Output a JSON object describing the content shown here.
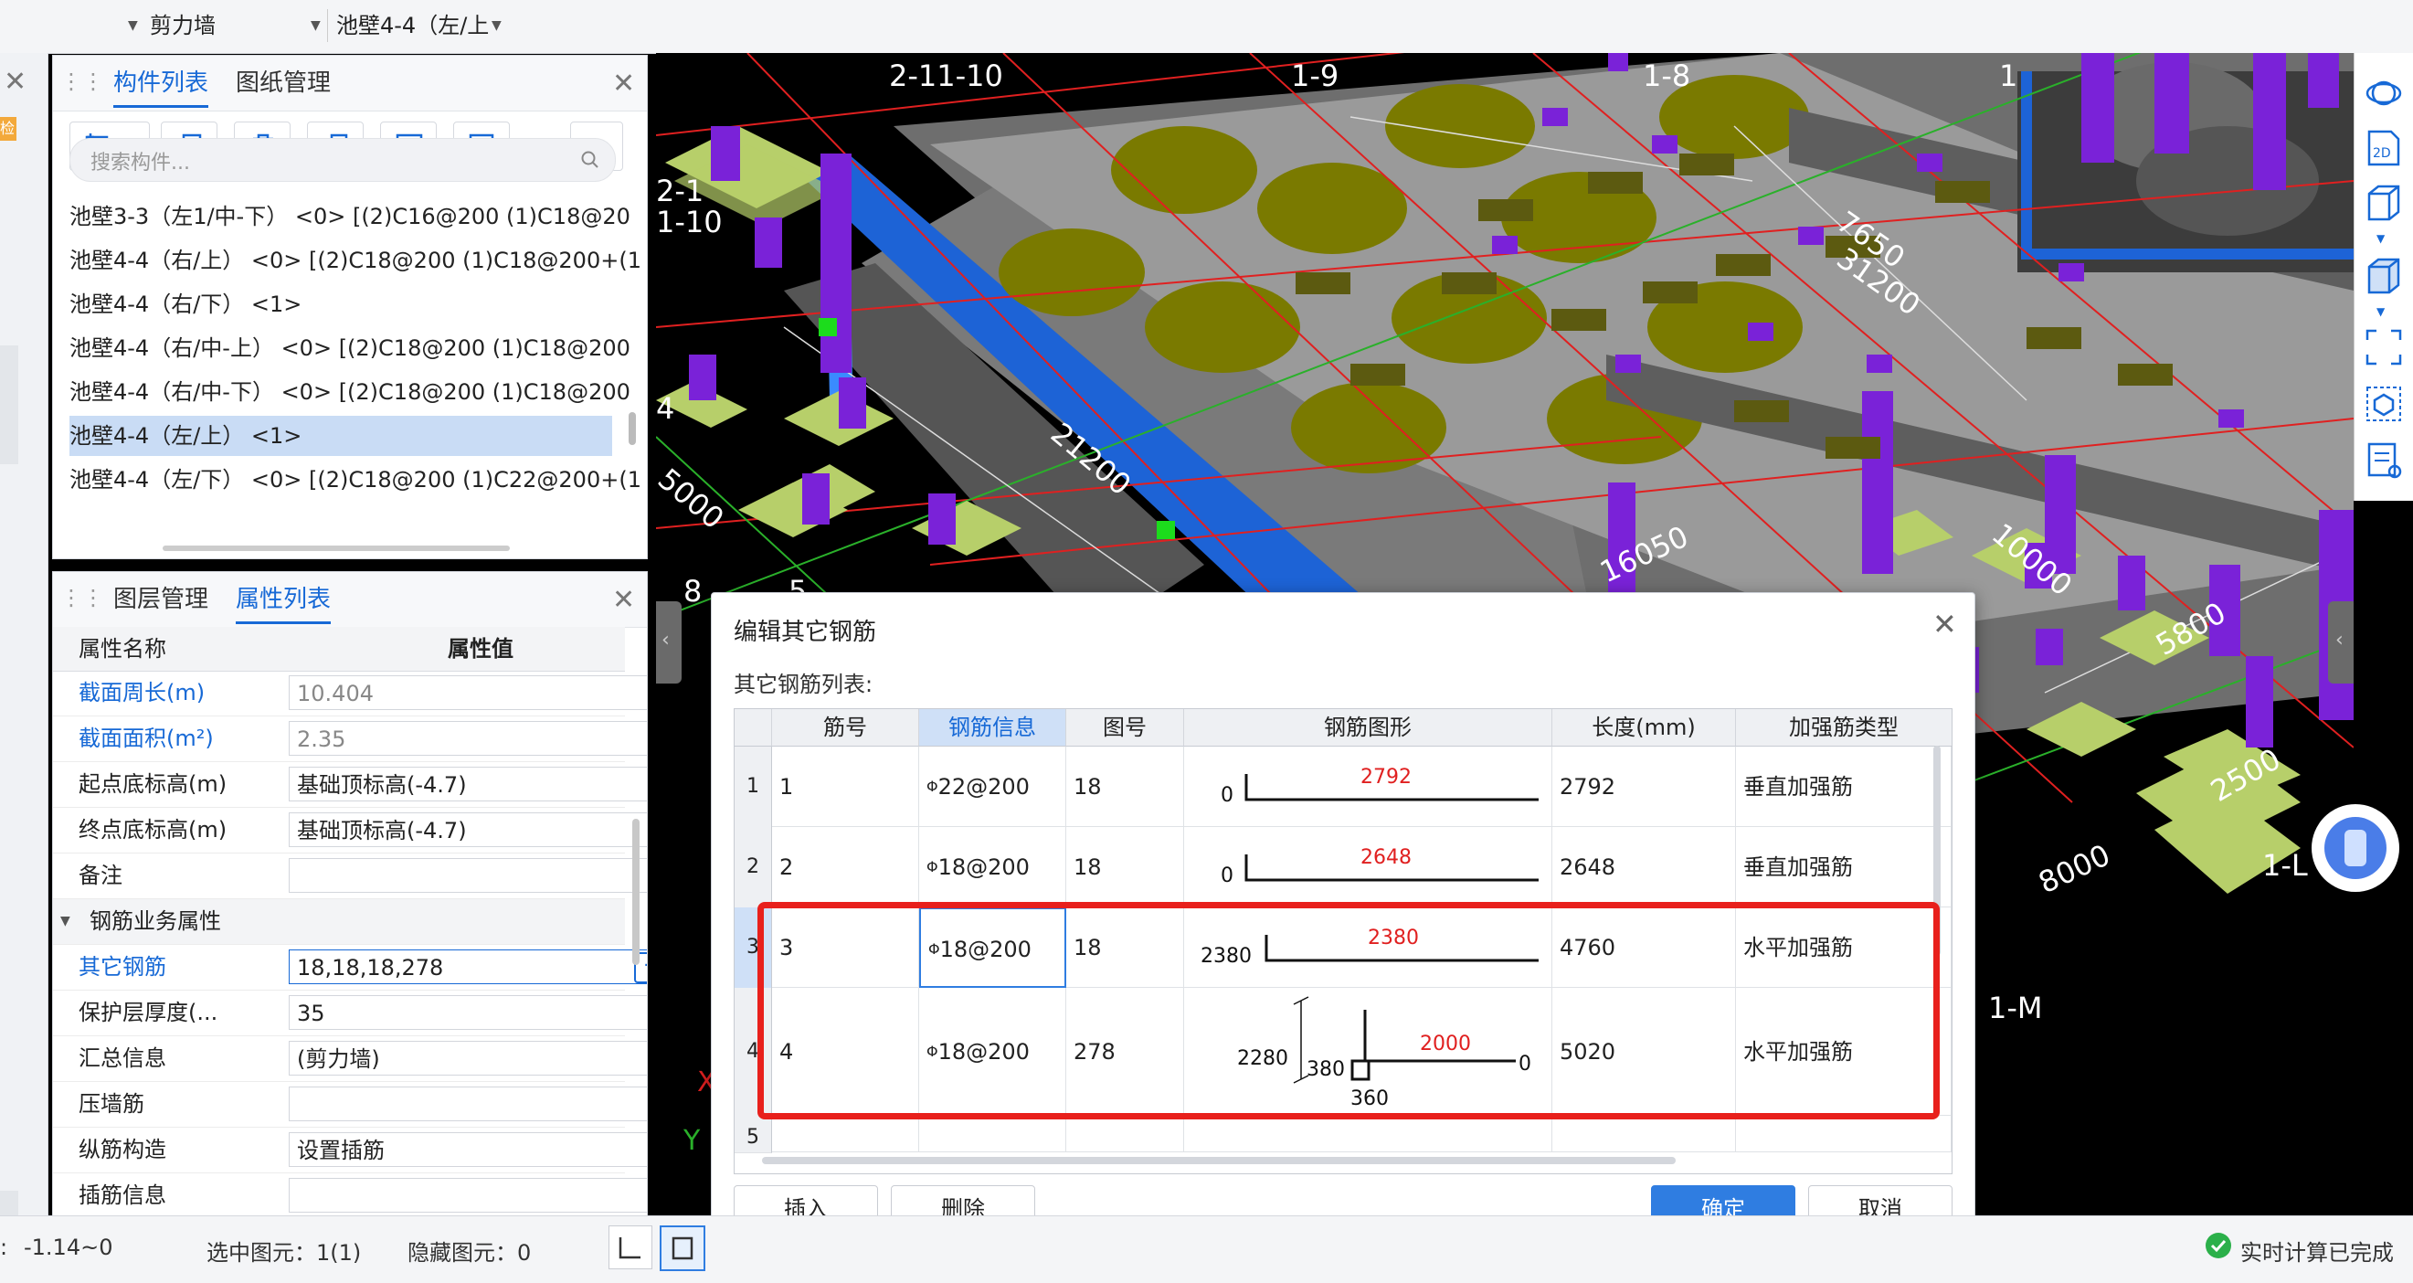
{
  "topbar": {
    "sel1_value": "剪力墙",
    "sel2_value": "池壁4-4（左/上",
    "left_fragment": "检"
  },
  "component_panel": {
    "tabs": [
      "构件列表",
      "图纸管理"
    ],
    "search_placeholder": "搜索构件...",
    "items": [
      "池壁3-3（左1/中-下） <0> [(2)C16@200 (1)C18@20",
      "池壁4-4（右/上） <0> [(2)C18@200 (1)C18@200+(1",
      "池壁4-4（右/下） <1>",
      "池壁4-4（右/中-上） <0> [(2)C18@200 (1)C18@200",
      "池壁4-4（右/中-下） <0> [(2)C18@200 (1)C18@200",
      "池壁4-4（左/上） <1>",
      "池壁4-4（左/下） <0> [(2)C18@200 (1)C22@200+(1"
    ],
    "selected_index": 5
  },
  "property_panel": {
    "tabs": [
      "图层管理",
      "属性列表"
    ],
    "col_name": "属性名称",
    "col_value": "属性值",
    "rows": [
      {
        "name": "截面周长(m)",
        "value": "10.404"
      },
      {
        "name": "截面面积(m²)",
        "value": "2.35"
      },
      {
        "name": "起点底标高(m)",
        "value": "基础顶标高(-4.7)"
      },
      {
        "name": "终点底标高(m)",
        "value": "基础顶标高(-4.7)"
      },
      {
        "name": "备注",
        "value": ""
      },
      {
        "name": "钢筋业务属性",
        "value": ""
      },
      {
        "name": "其它钢筋",
        "value": "18,18,18,278"
      },
      {
        "name": "保护层厚度(...",
        "value": "35"
      },
      {
        "name": "汇总信息",
        "value": "(剪力墙)"
      },
      {
        "name": "压墙筋",
        "value": ""
      },
      {
        "name": "纵筋构造",
        "value": "设置插筋"
      },
      {
        "name": "插筋信息",
        "value": ""
      }
    ],
    "more_button": "···"
  },
  "viewport": {
    "labels": [
      "2-11-10",
      "1-9",
      "1-8",
      "1",
      "2-1",
      "1-10",
      "7650",
      "31200",
      "21200",
      "5000",
      "16050",
      "10000",
      "5800",
      "2500",
      "8000",
      "1-L",
      "1-M",
      "8",
      "5",
      "4",
      "X",
      "Y",
      "1"
    ]
  },
  "dialog": {
    "title": "编辑其它钢筋",
    "list_label": "其它钢筋列表:",
    "columns": [
      "筋号",
      "钢筋信息",
      "图号",
      "钢筋图形",
      "长度(mm)",
      "加强筋类型"
    ],
    "rows": [
      {
        "num": "1",
        "bar_id": "1",
        "info": "22@200",
        "fig": "18",
        "length": "2792",
        "type": "垂直加强筋",
        "shape": {
          "left": "0",
          "top": "2792"
        }
      },
      {
        "num": "2",
        "bar_id": "2",
        "info": "18@200",
        "fig": "18",
        "length": "2648",
        "type": "垂直加强筋",
        "shape": {
          "left": "0",
          "top": "2648"
        }
      },
      {
        "num": "3",
        "bar_id": "3",
        "info": "18@200",
        "fig": "18",
        "length": "4760",
        "type": "水平加强筋",
        "shape": {
          "left": "2380",
          "top": "2380"
        }
      },
      {
        "num": "4",
        "bar_id": "4",
        "info": "18@200",
        "fig": "278",
        "length": "5020",
        "type": "水平加强筋",
        "shape": {
          "left": "2280",
          "mid": "380",
          "top": "2000",
          "right": "0",
          "bottom": "360"
        }
      },
      {
        "num": "5",
        "bar_id": "",
        "info": "",
        "fig": "",
        "length": "",
        "type": "",
        "shape": {}
      }
    ],
    "buttons": {
      "insert": "插入",
      "delete": "删除",
      "ok": "确定",
      "cancel": "取消"
    }
  },
  "statusbar": {
    "range": "-1.14~0",
    "selected": "选中图元：1(1)",
    "hidden": "隐藏图元：0",
    "calc_status": "实时计算已完成"
  },
  "colors": {
    "accent": "#1769d6",
    "highlight_box": "#e8201c",
    "column_purple": "#7a22d8",
    "pad_green": "#b7cf6a",
    "wall_gray": "#8c8c8c",
    "selected_wall_blue": "#1d63d6"
  }
}
